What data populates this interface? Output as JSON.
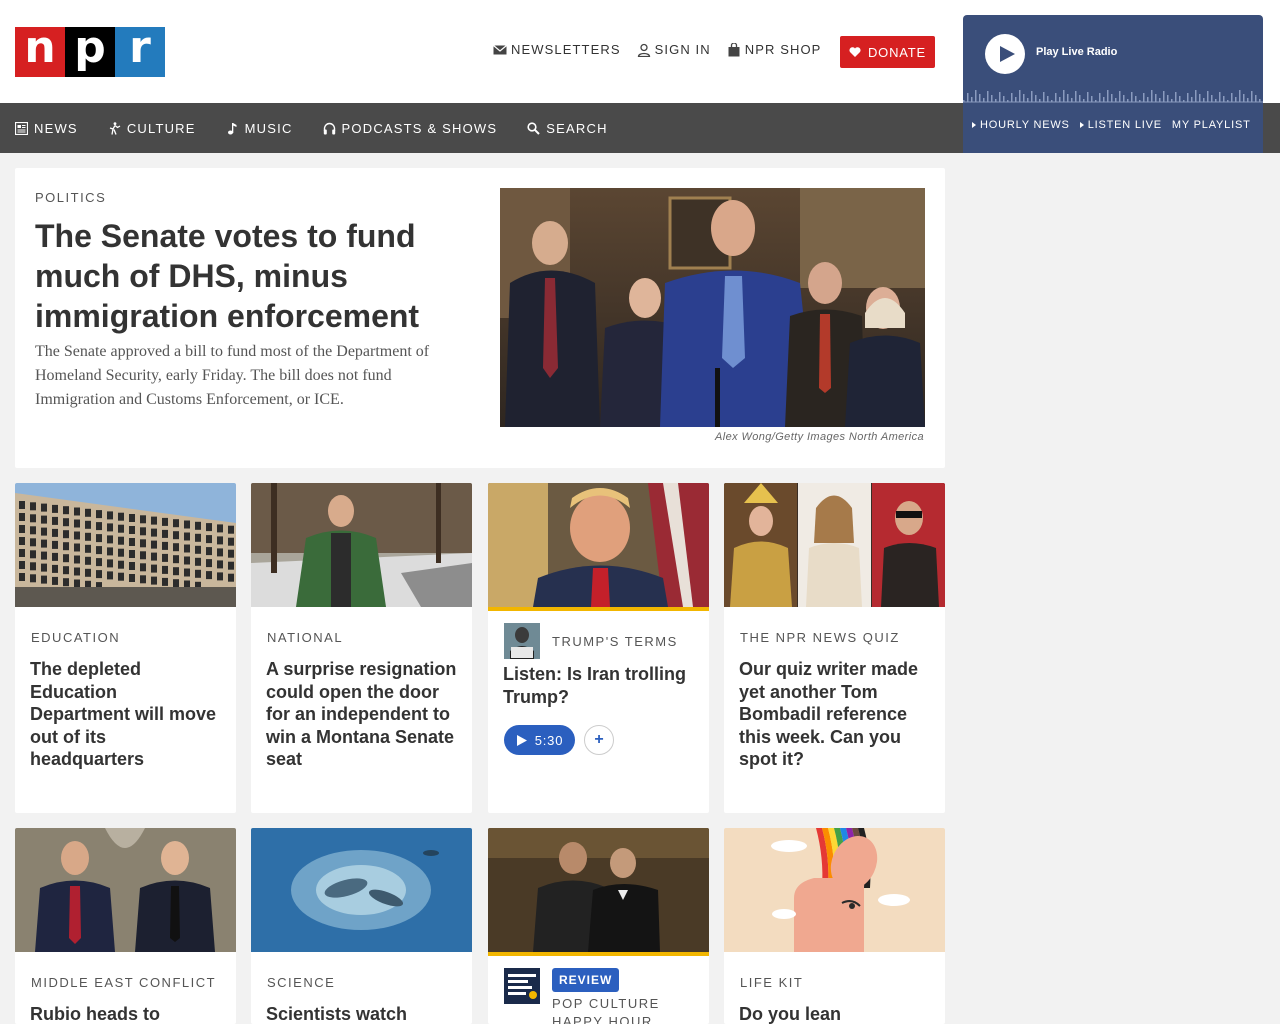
{
  "header": {
    "logo": {
      "l1": "n",
      "l2": "p",
      "l3": "r"
    },
    "utility": {
      "newsletters": "NEWSLETTERS",
      "sign_in": "SIGN IN",
      "shop": "NPR SHOP",
      "donate": "DONATE"
    }
  },
  "nav": {
    "items": [
      {
        "label": "NEWS",
        "icon": "news-icon"
      },
      {
        "label": "CULTURE",
        "icon": "culture-icon"
      },
      {
        "label": "MUSIC",
        "icon": "music-note-icon"
      },
      {
        "label": "PODCASTS & SHOWS",
        "icon": "headphones-icon"
      },
      {
        "label": "SEARCH",
        "icon": "search-icon"
      }
    ]
  },
  "player": {
    "title": "Play Live Radio",
    "links": {
      "hourly": "HOURLY NEWS",
      "listen": "LISTEN LIVE",
      "playlist": "MY PLAYLIST"
    }
  },
  "hero": {
    "slug": "POLITICS",
    "headline": "The Senate votes to fund much of DHS, minus immigration enforcement",
    "teaser": "The Senate approved a bill to fund most of the Department of Homeland Security, early Friday. The bill does not fund Immigration and Customs Enforcement, or ICE.",
    "credit": "Alex Wong/Getty Images North America"
  },
  "cards_row1": [
    {
      "slug": "EDUCATION",
      "title": "The depleted Education Department will move out of its headquarters"
    },
    {
      "slug": "NATIONAL",
      "title": "A surprise resignation could open the door for an independent to win a Montana Senate seat"
    },
    {
      "slug": "TRUMP'S TERMS",
      "title": "Listen: Is Iran trolling Trump?",
      "duration": "5:30",
      "add": "+"
    },
    {
      "slug": "THE NPR NEWS QUIZ",
      "title": "Our quiz writer made yet another Tom Bombadil reference this week. Can you spot it?"
    }
  ],
  "cards_row2": [
    {
      "slug": "MIDDLE EAST CONFLICT",
      "title": "Rubio heads to"
    },
    {
      "slug": "SCIENCE",
      "title": "Scientists watch"
    },
    {
      "badge": "REVIEW",
      "slug": "POP CULTURE HAPPY HOUR"
    },
    {
      "slug": "LIFE KIT",
      "title": "Do you lean"
    }
  ],
  "colors": {
    "brand_red": "#d62021",
    "brand_blue": "#237bbd",
    "nav_bg": "#4a4a4a",
    "player_bg": "#3a4e7a",
    "audio_blue": "#2b5fbf",
    "audio_accent": "#f2b600"
  }
}
